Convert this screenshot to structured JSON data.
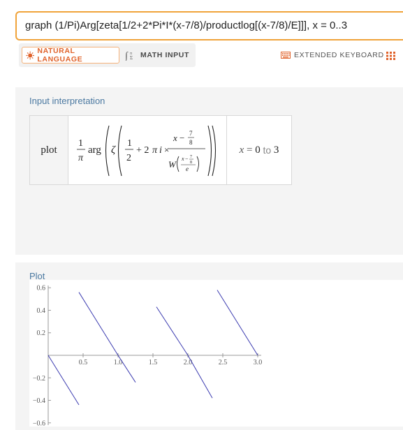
{
  "search": {
    "query": "graph (1/Pi)Arg[zeta[1/2+2*Pi*I*(x-7/8)/productlog[(x-7/8)/E]]], x = 0..3"
  },
  "modes": {
    "natural_language": "NATURAL LANGUAGE",
    "math_input": "MATH INPUT"
  },
  "keyboard": {
    "label": "EXTENDED KEYBOARD"
  },
  "input_pod": {
    "title": "Input interpretation",
    "head": "plot",
    "range_var": "x",
    "range_eq": "=",
    "range_from": "0",
    "range_to_kw": "to",
    "range_to": "3"
  },
  "plot_pod": {
    "title": "Plot"
  },
  "colors": {
    "accent": "#f0a33a",
    "nl_accent": "#e0622a",
    "pod_title": "#4a78a0",
    "curve": "#3b3bb0"
  },
  "chart_data": {
    "type": "line",
    "title": "",
    "xlabel": "",
    "ylabel": "",
    "xlim": [
      0,
      3.05
    ],
    "ylim": [
      -0.62,
      0.62
    ],
    "xticks": [
      0.5,
      1.0,
      1.5,
      2.0,
      2.5,
      3.0
    ],
    "xtick_labels": [
      "0.5",
      "1.0",
      "1.5",
      "2.0",
      "2.5",
      "3.0"
    ],
    "yticks": [
      0.6,
      0.4,
      0.2,
      -0.2,
      -0.4,
      -0.6
    ],
    "ytick_labels": [
      "0.6",
      "0.4",
      "0.2",
      "−0.2",
      "−0.4",
      "−0.6"
    ],
    "series": [
      {
        "segments": [
          {
            "x": [
              0.0,
              0.44
            ],
            "y": [
              0.0,
              -0.44
            ]
          },
          {
            "x": [
              0.44,
              1.0
            ],
            "y": [
              0.56,
              0.0
            ]
          },
          {
            "x": [
              1.0,
              1.25
            ],
            "y": [
              0.0,
              -0.24
            ]
          },
          {
            "x": [
              1.55,
              2.0
            ],
            "y": [
              0.43,
              0.0
            ]
          },
          {
            "x": [
              2.0,
              2.35
            ],
            "y": [
              0.0,
              -0.38
            ]
          },
          {
            "x": [
              2.42,
              3.0
            ],
            "y": [
              0.58,
              0.0
            ]
          }
        ]
      }
    ]
  }
}
